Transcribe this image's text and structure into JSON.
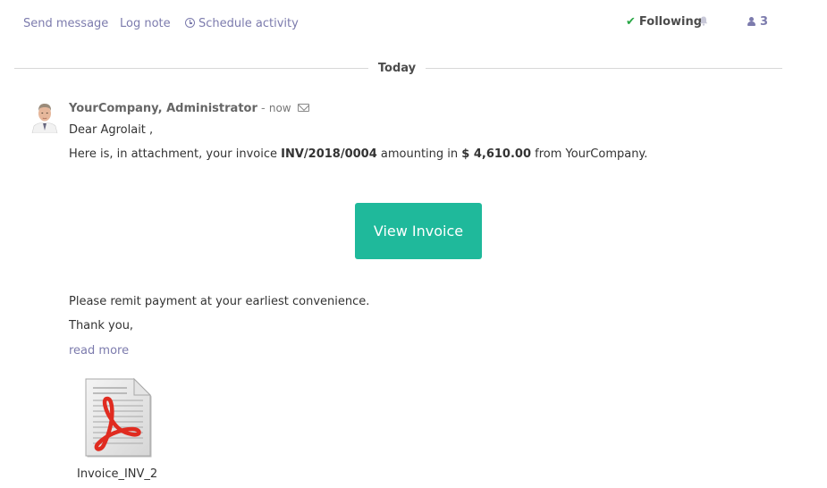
{
  "actions": {
    "send_message": "Send message",
    "log_note": "Log note",
    "schedule_activity": "Schedule activity"
  },
  "follow": {
    "following_label": "Following",
    "followers_count": "3"
  },
  "separator": {
    "label": "Today"
  },
  "message": {
    "author": "YourCompany, Administrator",
    "dash": " - ",
    "time": "now",
    "greeting": "Dear Agrolait ,",
    "line_intro": "Here is, in attachment, your invoice ",
    "invoice_ref": "INV/2018/0004",
    "line_mid": " amounting in ",
    "amount": "$ 4,610.00",
    "line_end": " from YourCompany.",
    "button_label": "View Invoice",
    "remit": "Please remit payment at your earliest convenience.",
    "thanks": "Thank you,",
    "read_more": "read more"
  },
  "attachment": {
    "name": "Invoice_INV_2",
    "icon": "pdf-file-icon"
  },
  "colors": {
    "link": "#7c7bad",
    "button": "#1fb99b",
    "check": "#28a745",
    "pdf_red": "#e02b20"
  }
}
